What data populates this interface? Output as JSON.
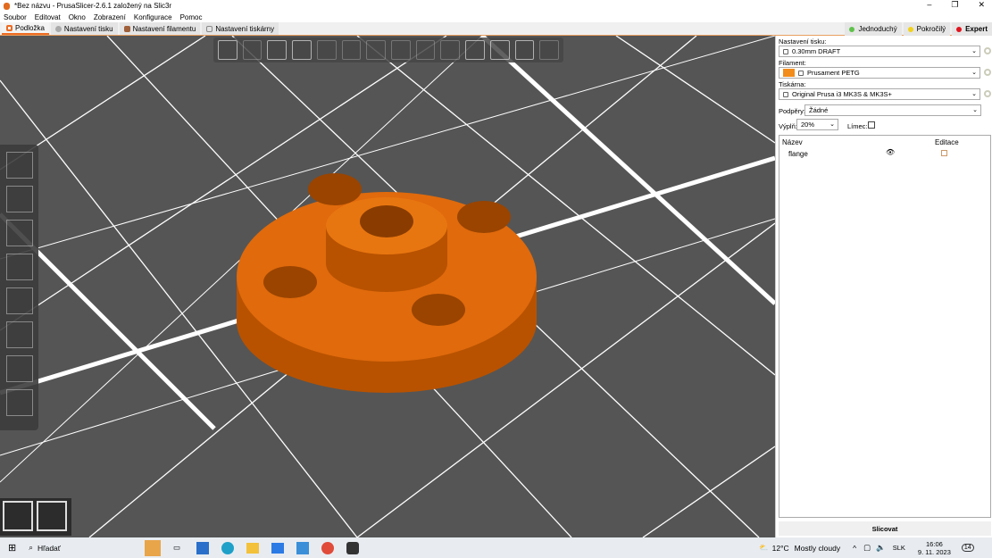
{
  "window": {
    "title": "*Bez názvu - PrusaSlicer-2.6.1 založený na Slic3r",
    "controls": [
      "–",
      "❐",
      "✕"
    ]
  },
  "menu": [
    "Soubor",
    "Editovat",
    "Okno",
    "Zobrazení",
    "Konfigurace",
    "Pomoc"
  ],
  "tabs": [
    {
      "label": "Podložka",
      "color": "#ed6b21"
    },
    {
      "label": "Nastavení tisku",
      "color": "#999999"
    },
    {
      "label": "Nastavení filamentu",
      "color": "#a0603a"
    },
    {
      "label": "Nastavení tiskárny",
      "color": "#bbbbbb"
    }
  ],
  "modes": [
    {
      "label": "Jednoduchý",
      "color": "#5ec24a"
    },
    {
      "label": "Pokročilý",
      "color": "#f2d21b"
    },
    {
      "label": "Expert",
      "color": "#e0141e"
    }
  ],
  "panel": {
    "print_label": "Nastavení tisku:",
    "print_value": "0.30mm DRAFT",
    "filament_label": "Filament:",
    "filament_value": "Prusament PETG",
    "filament_color": "#f28c1a",
    "printer_label": "Tiskárna:",
    "printer_value": "Original Prusa i3 MK3S & MK3S+",
    "supports_label": "Podpěry:",
    "supports_value": "Žádné",
    "infill_label": "Výplň:",
    "infill_value": "20%",
    "brim_label": "Límec:",
    "brim_checked": false,
    "columns": [
      "Název",
      "Editace"
    ],
    "objects": [
      {
        "name": "flange"
      }
    ],
    "slice_button": "Slicovat"
  },
  "model_color": "#e06a0c",
  "taskbar": {
    "search": "Hľadať",
    "weather_temp": "12°C",
    "weather_text": "Mostly cloudy",
    "lang": "SLK",
    "time": "16:06",
    "date": "9. 11. 2023",
    "notifications": "14"
  }
}
